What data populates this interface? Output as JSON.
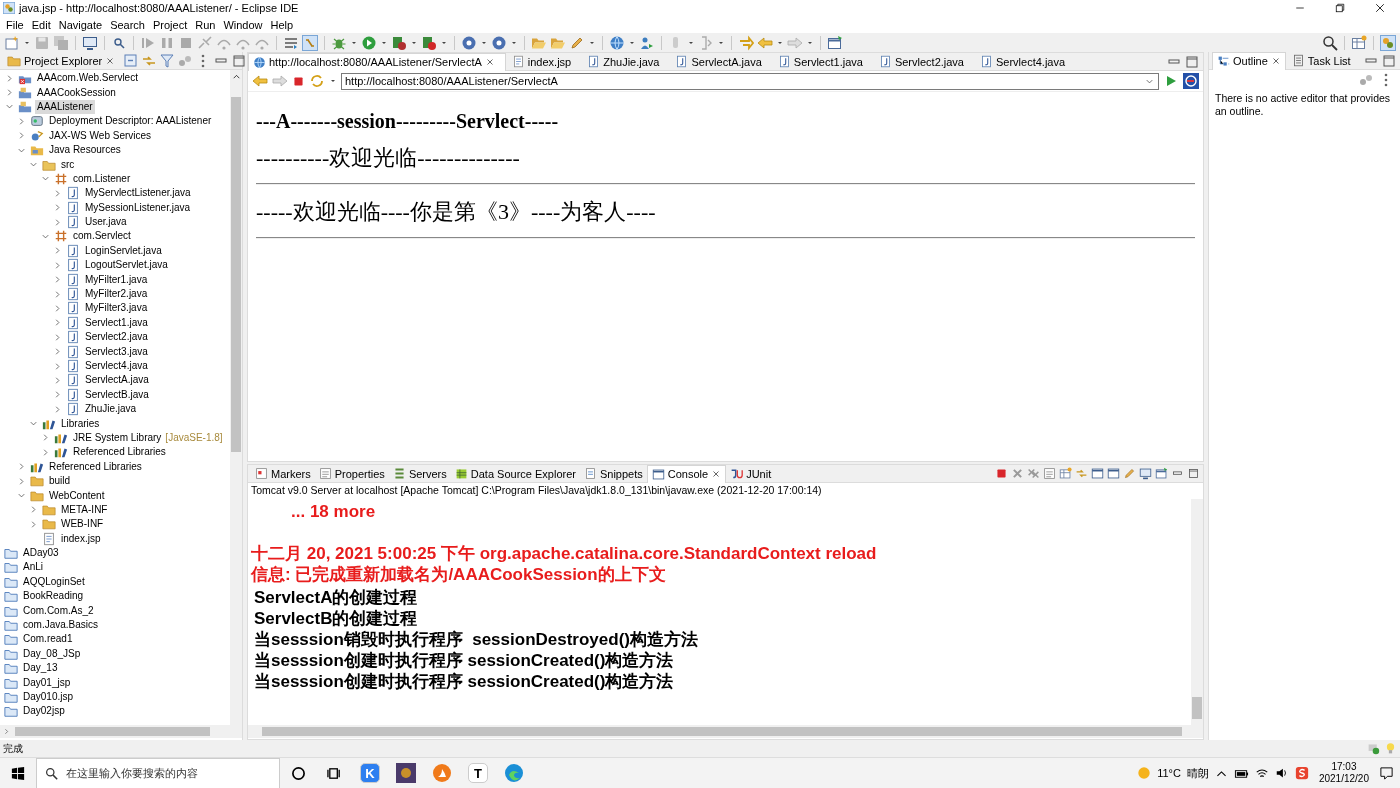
{
  "window": {
    "title": "java.jsp - http://localhost:8080/AAAListener/ - Eclipse IDE"
  },
  "menu": [
    "File",
    "Edit",
    "Navigate",
    "Search",
    "Project",
    "Run",
    "Window",
    "Help"
  ],
  "explorer": {
    "title": "Project Explorer",
    "tree": [
      {
        "label": "AAAcom.Web.Servlect",
        "kind": "project-error",
        "expanded": false,
        "selected": false
      },
      {
        "label": "AAACookSession",
        "kind": "project",
        "expanded": false,
        "selected": false
      },
      {
        "label": "AAAListener",
        "kind": "project",
        "expanded": true,
        "selected": true,
        "children": [
          {
            "label": "Deployment Descriptor: AAAListener",
            "kind": "descriptor",
            "expanded": false,
            "selected": false
          },
          {
            "label": "JAX-WS Web Services",
            "kind": "webservices",
            "expanded": false,
            "selected": false
          },
          {
            "label": "Java Resources",
            "kind": "resources",
            "expanded": true,
            "selected": false,
            "children": [
              {
                "label": "src",
                "kind": "srcfolder",
                "expanded": true,
                "selected": false,
                "children": [
                  {
                    "label": "com.Listener",
                    "kind": "package",
                    "expanded": true,
                    "selected": false,
                    "children": [
                      {
                        "label": "MyServlectListener.java",
                        "kind": "java",
                        "expanded": false,
                        "selected": false
                      },
                      {
                        "label": "MySessionListener.java",
                        "kind": "java",
                        "expanded": false,
                        "selected": false
                      },
                      {
                        "label": "User.java",
                        "kind": "java",
                        "expanded": false,
                        "selected": false
                      }
                    ]
                  },
                  {
                    "label": "com.Servlect",
                    "kind": "package",
                    "expanded": true,
                    "selected": false,
                    "children": [
                      {
                        "label": "LoginServlet.java",
                        "kind": "java",
                        "expanded": false,
                        "selected": false
                      },
                      {
                        "label": "LogoutServlet.java",
                        "kind": "java",
                        "expanded": false,
                        "selected": false
                      },
                      {
                        "label": "MyFilter1.java",
                        "kind": "java",
                        "expanded": false,
                        "selected": false
                      },
                      {
                        "label": "MyFilter2.java",
                        "kind": "java",
                        "expanded": false,
                        "selected": false
                      },
                      {
                        "label": "MyFilter3.java",
                        "kind": "java",
                        "expanded": false,
                        "selected": false
                      },
                      {
                        "label": "Servlect1.java",
                        "kind": "java",
                        "expanded": false,
                        "selected": false
                      },
                      {
                        "label": "Servlect2.java",
                        "kind": "java",
                        "expanded": false,
                        "selected": false
                      },
                      {
                        "label": "Servlect3.java",
                        "kind": "java",
                        "expanded": false,
                        "selected": false
                      },
                      {
                        "label": "Servlect4.java",
                        "kind": "java",
                        "expanded": false,
                        "selected": false
                      },
                      {
                        "label": "ServlectA.java",
                        "kind": "java",
                        "expanded": false,
                        "selected": false
                      },
                      {
                        "label": "ServlectB.java",
                        "kind": "java",
                        "expanded": false,
                        "selected": false
                      },
                      {
                        "label": "ZhuJie.java",
                        "kind": "java",
                        "expanded": false,
                        "selected": false
                      }
                    ]
                  }
                ]
              },
              {
                "label": "Libraries",
                "kind": "library",
                "expanded": true,
                "selected": false,
                "children": [
                  {
                    "label": "JRE System Library",
                    "decoration": "[JavaSE-1.8]",
                    "kind": "library",
                    "expanded": false,
                    "selected": false
                  },
                  {
                    "label": "Referenced Libraries",
                    "kind": "library",
                    "expanded": false,
                    "selected": false
                  }
                ]
              }
            ]
          },
          {
            "label": "Referenced Libraries",
            "kind": "library",
            "expanded": false,
            "selected": false
          },
          {
            "label": "build",
            "kind": "folder",
            "expanded": false,
            "selected": false
          },
          {
            "label": "WebContent",
            "kind": "folder",
            "expanded": true,
            "selected": false,
            "children": [
              {
                "label": "META-INF",
                "kind": "folder",
                "expanded": false,
                "selected": false
              },
              {
                "label": "WEB-INF",
                "kind": "folder",
                "expanded": false,
                "selected": false
              },
              {
                "label": "index.jsp",
                "kind": "file",
                "selected": false
              }
            ]
          }
        ]
      },
      {
        "label": "ADay03",
        "kind": "closed-project",
        "selected": false
      },
      {
        "label": "AnLi",
        "kind": "closed-project",
        "selected": false
      },
      {
        "label": "AQQLoginSet",
        "kind": "closed-project",
        "selected": false
      },
      {
        "label": "BookReading",
        "kind": "closed-project",
        "selected": false
      },
      {
        "label": "Com.Com.As_2",
        "kind": "closed-project",
        "selected": false
      },
      {
        "label": "com.Java.Basics",
        "kind": "closed-project",
        "selected": false
      },
      {
        "label": "Com.read1",
        "kind": "closed-project",
        "selected": false
      },
      {
        "label": "Day_08_JSp",
        "kind": "closed-project",
        "selected": false
      },
      {
        "label": "Day_13",
        "kind": "closed-project",
        "selected": false
      },
      {
        "label": "Day01_jsp",
        "kind": "closed-project",
        "selected": false
      },
      {
        "label": "Day010.jsp",
        "kind": "closed-project",
        "selected": false
      },
      {
        "label": "Day02jsp",
        "kind": "closed-project",
        "selected": false
      }
    ]
  },
  "editor": {
    "tabs": [
      {
        "label": "http://localhost:8080/AAAListener/ServlectA",
        "kind": "browser",
        "selected": true
      },
      {
        "label": "index.jsp",
        "kind": "jsp",
        "selected": false
      },
      {
        "label": "ZhuJie.java",
        "kind": "java",
        "selected": false
      },
      {
        "label": "ServlectA.java",
        "kind": "java",
        "selected": false
      },
      {
        "label": "Servlect1.java",
        "kind": "java",
        "selected": false
      },
      {
        "label": "Servlect2.java",
        "kind": "java",
        "selected": false
      },
      {
        "label": "Servlect4.java",
        "kind": "java",
        "selected": false
      }
    ],
    "address": "http://localhost:8080/AAAListener/ServlectA",
    "page": [
      {
        "kind": "heading",
        "text": "---A-------session---------Servlect-----"
      },
      {
        "kind": "text",
        "text": "----------欢迎光临--------------"
      },
      {
        "kind": "rule"
      },
      {
        "kind": "text",
        "text": "-----欢迎光临----你是第《3》----为客人----"
      },
      {
        "kind": "rule"
      }
    ]
  },
  "outline": {
    "tabs": [
      {
        "label": "Outline",
        "kind": "outline",
        "selected": true
      },
      {
        "label": "Task List",
        "kind": "tasks",
        "selected": false
      }
    ],
    "message": "There is no active editor that provides an outline."
  },
  "console": {
    "tabs": [
      {
        "label": "Markers",
        "kind": "markers",
        "selected": false
      },
      {
        "label": "Properties",
        "kind": "properties",
        "selected": false
      },
      {
        "label": "Servers",
        "kind": "servers",
        "selected": false
      },
      {
        "label": "Data Source Explorer",
        "kind": "datasource",
        "selected": false
      },
      {
        "label": "Snippets",
        "kind": "snippets",
        "selected": false
      },
      {
        "label": "Console",
        "kind": "console",
        "selected": true
      },
      {
        "label": "JUnit",
        "kind": "junit",
        "selected": false
      }
    ],
    "description": "Tomcat v9.0 Server at localhost [Apache Tomcat] C:\\Program Files\\Java\\jdk1.8.0_131\\bin\\javaw.exe  (2021-12-20 17:00:14)",
    "lines": [
      {
        "kind": "trace",
        "error": true,
        "text": "... 18 more"
      },
      {
        "kind": "blank"
      },
      {
        "kind": "message",
        "error": true,
        "text": "十二月 20, 2021 5:00:25 下午 org.apache.catalina.core.StandardContext reload"
      },
      {
        "kind": "message",
        "error": true,
        "text": "信息: 已完成重新加载名为/AAACookSession的上下文"
      },
      {
        "kind": "message",
        "error": false,
        "text": "ServlectA的创建过程"
      },
      {
        "kind": "message",
        "error": false,
        "text": "ServlectB的创建过程"
      },
      {
        "kind": "message",
        "error": false,
        "text": "当sesssion销毁时执行程序  sessionDestroyed()构造方法"
      },
      {
        "kind": "message",
        "error": false,
        "text": "当sesssion创建时执行程序 sessionCreated()构造方法"
      },
      {
        "kind": "message",
        "error": false,
        "text": "当sesssion创建时执行程序 sessionCreated()构造方法"
      }
    ]
  },
  "status_bar": {
    "text": "完成"
  },
  "taskbar": {
    "search_placeholder": "在这里输入你要搜索的内容",
    "apps": [
      {
        "kind": "letter",
        "glyph": "K",
        "color": "#2d7ff0"
      },
      {
        "kind": "picture-app",
        "color": "#4a3a6a"
      },
      {
        "kind": "flame",
        "color": "#f07a1a"
      },
      {
        "kind": "letter",
        "glyph": "T",
        "color": "#ffffff"
      },
      {
        "kind": "edge",
        "color": "#1a8fd6"
      }
    ],
    "temperature": "11°C",
    "weather": "晴朗",
    "time": "17:03",
    "date": "2021/12/20"
  }
}
